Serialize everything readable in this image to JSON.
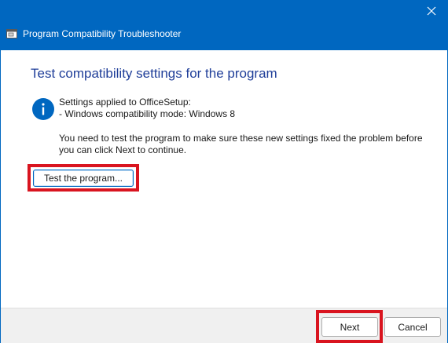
{
  "window": {
    "title": "Program Compatibility Troubleshooter",
    "close_symbol": "×"
  },
  "main": {
    "heading": "Test compatibility settings for the program",
    "settings_title": "Settings applied to OfficeSetup:",
    "settings_line": "- Windows compatibility mode: Windows 8",
    "message": "You need to test the program to make sure these new settings fixed the problem before you can click Next to continue.",
    "test_button_label": "Test the program..."
  },
  "footer": {
    "next_label": "Next",
    "cancel_label": "Cancel"
  },
  "icons": {
    "app": "troubleshooter-app-icon",
    "info": "info-icon",
    "close": "close-icon"
  },
  "colors": {
    "title_bar": "#0067c0",
    "heading": "#1f3e99",
    "highlight": "#d9141f",
    "info_icon": "#0067c0"
  }
}
